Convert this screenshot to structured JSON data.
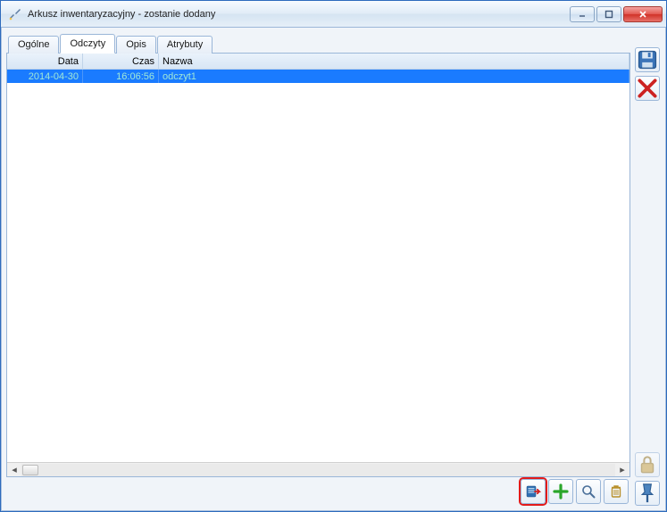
{
  "window": {
    "title": "Arkusz inwentaryzacyjny - zostanie dodany"
  },
  "tabs": [
    {
      "label": "Ogólne"
    },
    {
      "label": "Odczyty"
    },
    {
      "label": "Opis"
    },
    {
      "label": "Atrybuty"
    }
  ],
  "active_tab_index": 1,
  "grid": {
    "columns": {
      "date": "Data",
      "time": "Czas",
      "name": "Nazwa"
    },
    "rows": [
      {
        "date": "2014-04-30",
        "time": "16:06:56",
        "name": "odczyt1"
      }
    ]
  },
  "toolbar": {
    "open": "open",
    "add": "add",
    "search": "search",
    "delete": "delete"
  },
  "side": {
    "save": "save",
    "cancel": "cancel",
    "lock": "lock",
    "pin": "pin"
  }
}
